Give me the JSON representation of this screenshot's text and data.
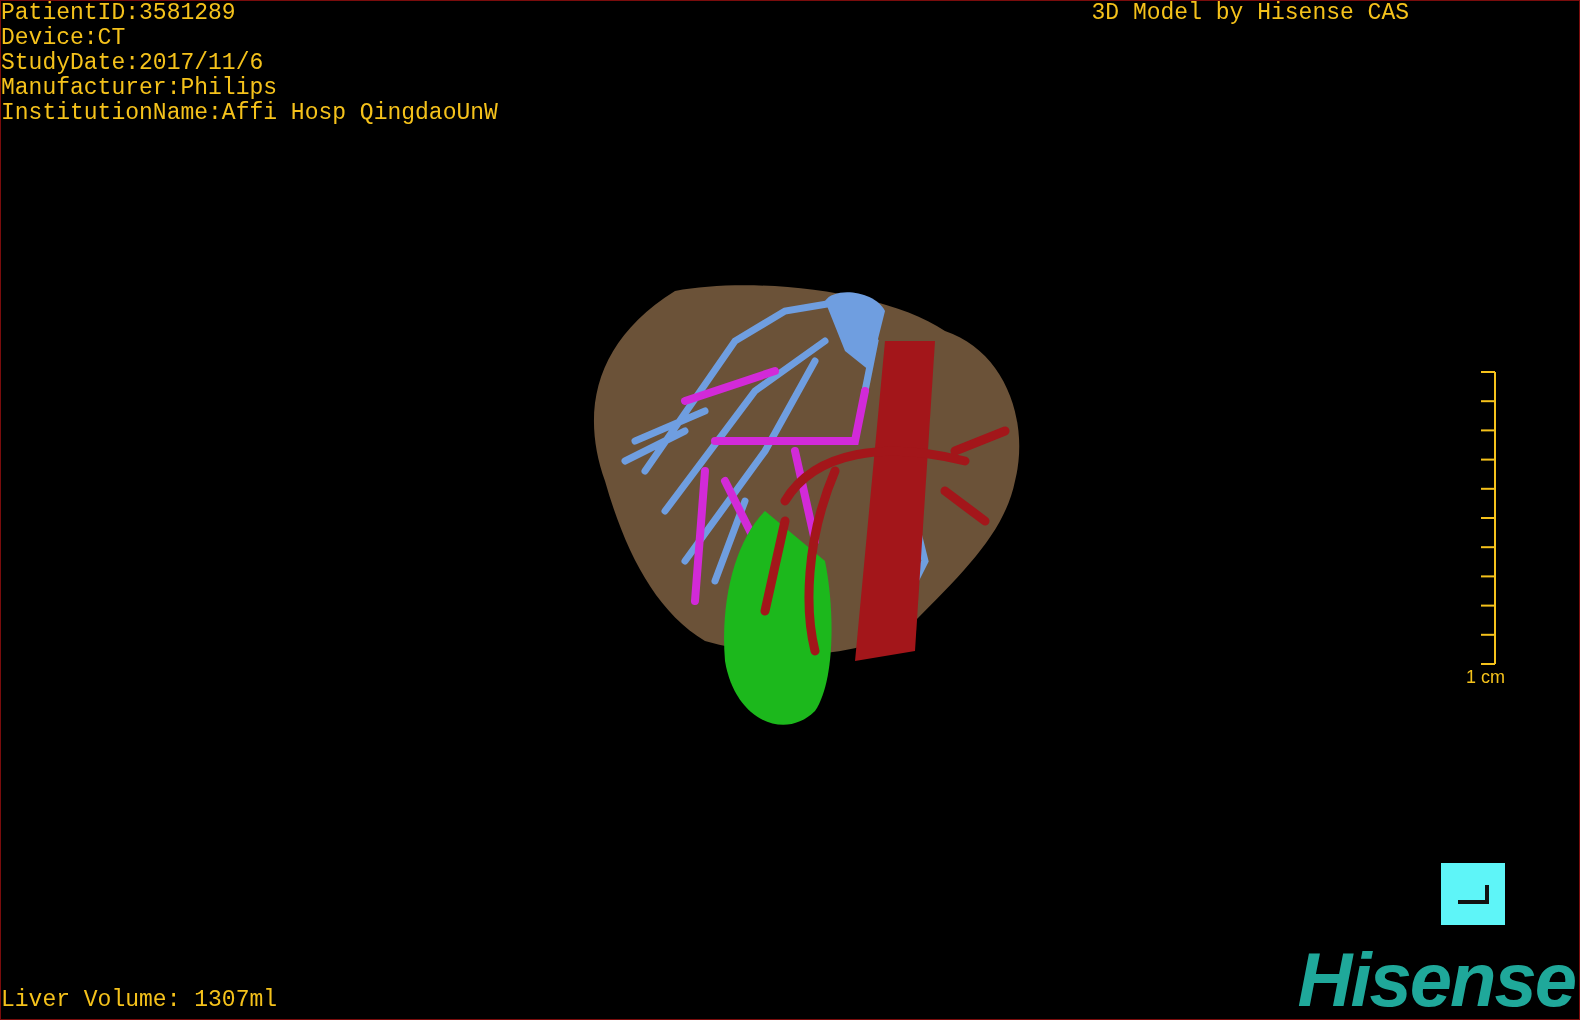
{
  "patient_info": [
    "PatientID:3581289",
    "Device:CT",
    "StudyDate:2017/11/6",
    "Manufacturer:Philips",
    "InstitutionName:Affi Hosp QingdaoUnW"
  ],
  "title": "3D Model by Hisense CAS",
  "scale_bar": {
    "label": "1 cm"
  },
  "liver_volume": "Liver Volume: 1307ml",
  "logo": "Hisense"
}
